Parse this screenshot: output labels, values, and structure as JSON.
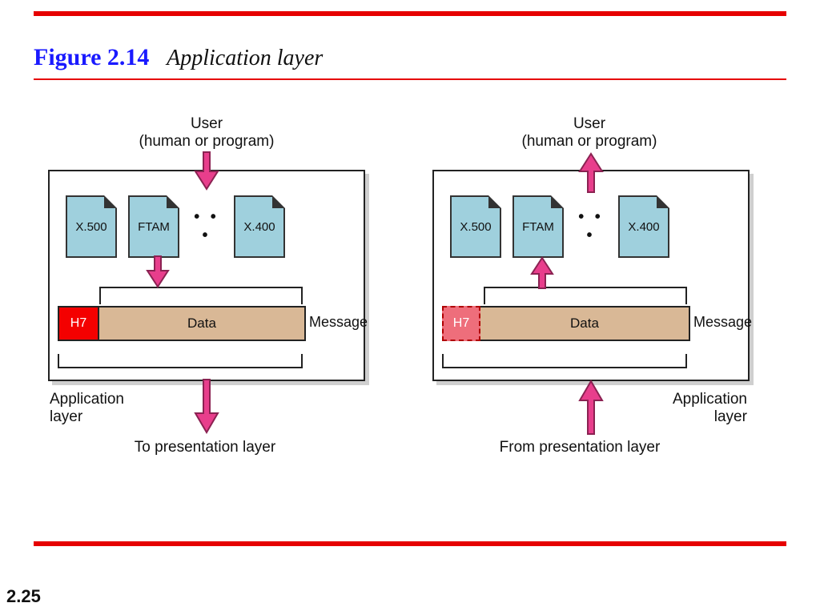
{
  "figure": {
    "number": "Figure 2.14",
    "name": "Application layer"
  },
  "page_number": "2.25",
  "user_label_line1": "User",
  "user_label_line2": "(human or program)",
  "app_layer_line1": "Application",
  "app_layer_line2": "layer",
  "to_presentation": "To presentation layer",
  "from_presentation": "From presentation layer",
  "files": {
    "x500": "X.500",
    "ftam": "FTAM",
    "x400": "X.400"
  },
  "dots": "• • •",
  "header": "H7",
  "data_label": "Data",
  "message_label": "Message"
}
